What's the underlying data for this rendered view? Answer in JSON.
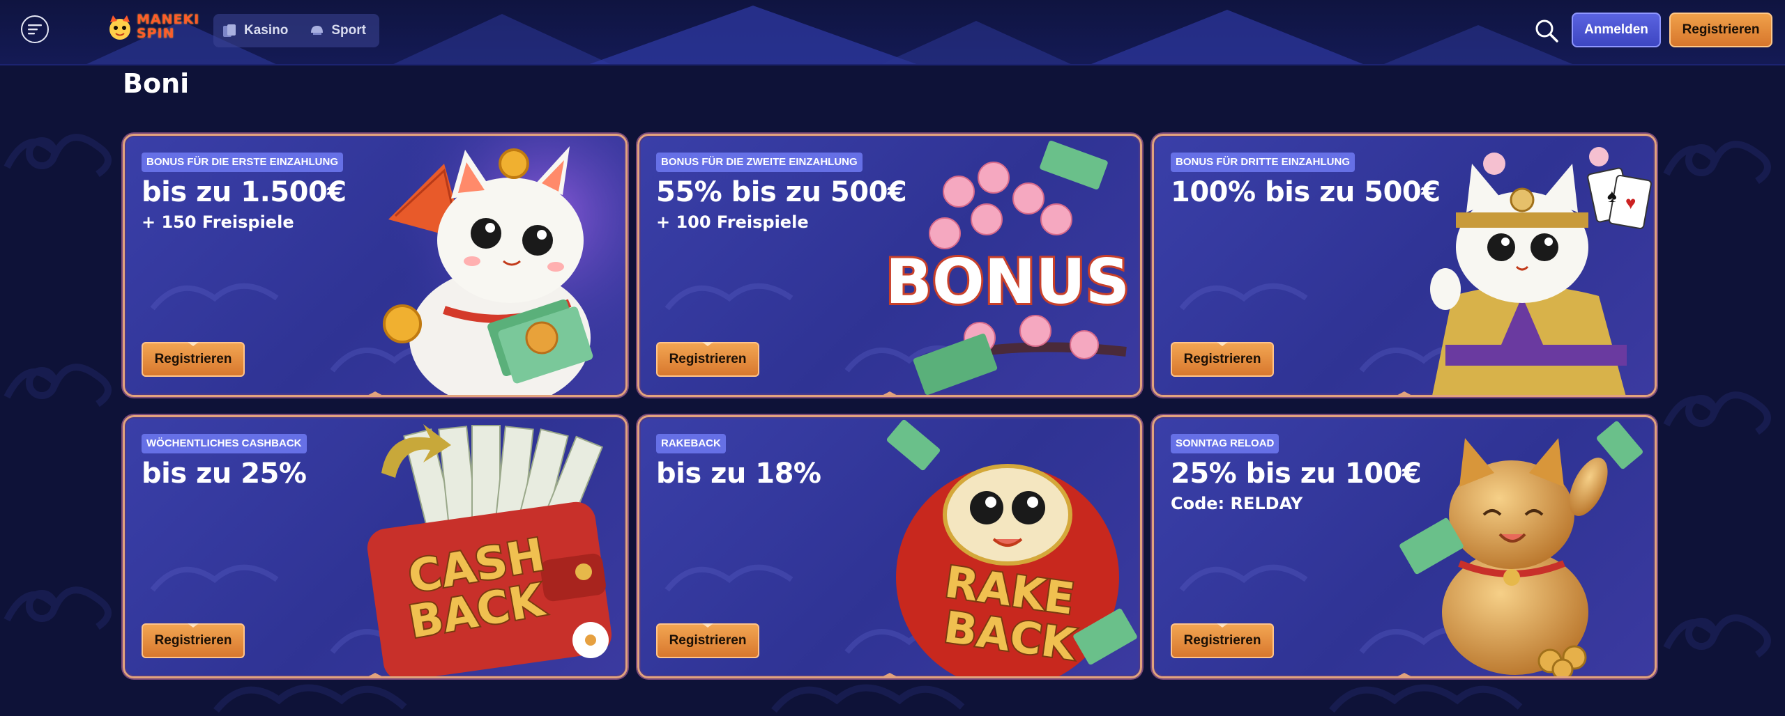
{
  "header": {
    "logo_text_line1": "MANEKI",
    "logo_text_line2": "SPIN",
    "nav": [
      {
        "label": "Kasino",
        "icon": "cards-icon"
      },
      {
        "label": "Sport",
        "icon": "helmet-icon"
      }
    ],
    "login_label": "Anmelden",
    "register_label": "Registrieren"
  },
  "page_title": "Boni",
  "cards": [
    {
      "badge": "BONUS FÜR DIE ERSTE EINZAHLUNG",
      "headline": "bis zu 1.500€",
      "subline": "+ 150 Freispiele",
      "cta": "Registrieren",
      "art": "maneki-cat-fan-art"
    },
    {
      "badge": "BONUS FÜR DIE ZWEITE EINZAHLUNG",
      "headline": "55% bis zu 500€",
      "subline": "+ 100 Freispiele",
      "cta": "Registrieren",
      "art": "bonus-blossom-art",
      "art_text": "BONUS"
    },
    {
      "badge": "BONUS FÜR DRITTE EINZAHLUNG",
      "headline": "100% bis zu 500€",
      "subline": "",
      "cta": "Registrieren",
      "art": "kimono-cat-cards-art"
    },
    {
      "badge": "WÖCHENTLICHES CASHBACK",
      "headline": "bis zu 25%",
      "subline": "",
      "cta": "Registrieren",
      "art": "cashback-wallet-art",
      "art_text_1": "CASH",
      "art_text_2": "BACK"
    },
    {
      "badge": "RAKEBACK",
      "headline": "bis zu 18%",
      "subline": "",
      "cta": "Registrieren",
      "art": "daruma-rakeback-art",
      "art_text_1": "RAKE",
      "art_text_2": "BACK"
    },
    {
      "badge": "SONNTAG RELOAD",
      "headline": "25% bis zu 100€",
      "subline": "Code: RELDAY",
      "cta": "Registrieren",
      "art": "golden-cat-art"
    }
  ],
  "colors": {
    "page_bg": "#0e1238",
    "card_bg": "#3437a0",
    "card_border": "#e2a37d",
    "badge_bg": "#6670e6",
    "cta_orange": "#e08a3a",
    "login_blue": "#4a53d2"
  }
}
